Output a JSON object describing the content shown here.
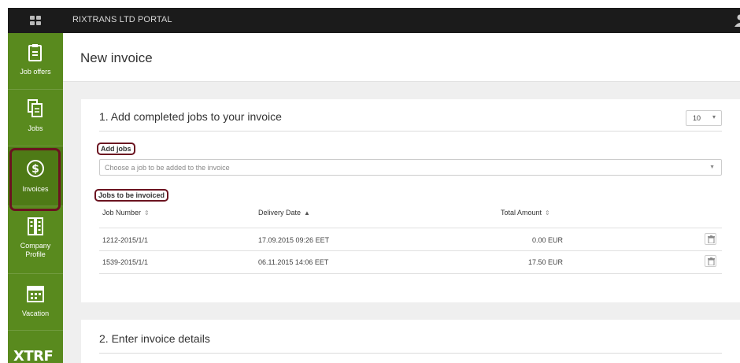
{
  "topbar": {
    "title": "RIXTRANS LTD PORTAL",
    "icon": "user-icon"
  },
  "sidebar": {
    "items": [
      {
        "label": "Job offers",
        "icon": "job-offers-icon"
      },
      {
        "label": "Jobs",
        "icon": "jobs-icon"
      },
      {
        "label": "Invoices",
        "icon": "dollar-icon",
        "active": true
      },
      {
        "label": "Company Profile",
        "icon": "company-profile-icon"
      },
      {
        "label": "Vacation",
        "icon": "calendar-icon"
      }
    ],
    "logo": "XTRF"
  },
  "page": {
    "title": "New invoice"
  },
  "section1": {
    "title": "1. Add completed jobs to your invoice",
    "per_page": "10",
    "add_jobs_label": "Add jobs",
    "select_placeholder": "Choose a job to be added to the invoice",
    "jobs_label": "Jobs to be invoiced",
    "columns": [
      "Job Number",
      "Delivery Date",
      "Total Amount"
    ],
    "rows": [
      {
        "job": "1212-2015/1/1",
        "date": "17.09.2015 09:26 EET",
        "amount": "0.00 EUR"
      },
      {
        "job": "1539-2015/1/1",
        "date": "06.11.2015 14:06 EET",
        "amount": "17.50 EUR"
      }
    ]
  },
  "section2": {
    "title": "2. Enter invoice details"
  },
  "colors": {
    "sidebar": "#598a1e",
    "highlight": "#6b1320",
    "topbar": "#1b1b1b"
  }
}
